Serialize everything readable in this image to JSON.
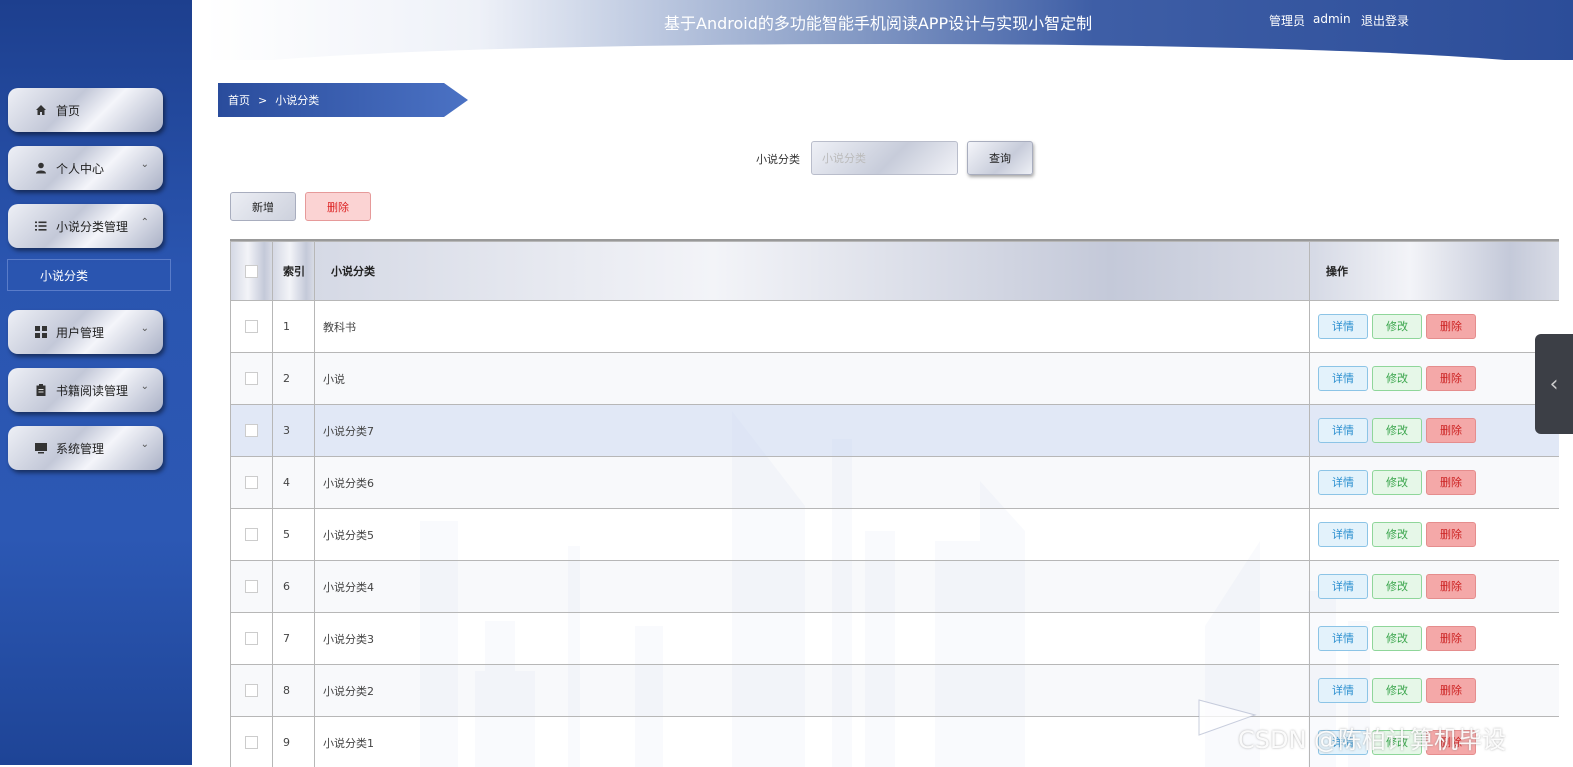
{
  "header": {
    "title": "基于Android的多功能智能手机阅读APP设计与实现小智定制",
    "user_role": "管理员",
    "user_name": "admin",
    "logout": "退出登录"
  },
  "sidebar": {
    "items": [
      {
        "label": "首页",
        "icon": "home-icon"
      },
      {
        "label": "个人中心",
        "icon": "user-icon",
        "expand": "collapsed"
      },
      {
        "label": "小说分类管理",
        "icon": "list-icon",
        "expand": "expanded"
      },
      {
        "label": "用户管理",
        "icon": "grid-icon",
        "expand": "collapsed"
      },
      {
        "label": "书籍阅读管理",
        "icon": "clipboard-icon",
        "expand": "collapsed"
      },
      {
        "label": "系统管理",
        "icon": "monitor-icon",
        "expand": "collapsed"
      }
    ],
    "subitem": "小说分类"
  },
  "breadcrumb": {
    "home": "首页",
    "sep": ">",
    "current": "小说分类"
  },
  "search": {
    "label": "小说分类",
    "placeholder": "小说分类",
    "button": "查询"
  },
  "toolbar": {
    "add": "新增",
    "delete": "删除"
  },
  "table": {
    "headers": {
      "index": "索引",
      "name": "小说分类",
      "ops": "操作"
    },
    "ops": {
      "detail": "详情",
      "edit": "修改",
      "delete": "删除"
    },
    "rows": [
      {
        "index": "1",
        "name": "教科书"
      },
      {
        "index": "2",
        "name": "小说"
      },
      {
        "index": "3",
        "name": "小说分类7"
      },
      {
        "index": "4",
        "name": "小说分类6"
      },
      {
        "index": "5",
        "name": "小说分类5"
      },
      {
        "index": "6",
        "name": "小说分类4"
      },
      {
        "index": "7",
        "name": "小说分类3"
      },
      {
        "index": "8",
        "name": "小说分类2"
      },
      {
        "index": "9",
        "name": "小说分类1"
      }
    ]
  },
  "watermark": "CSDN @陈柏计算机毕设"
}
